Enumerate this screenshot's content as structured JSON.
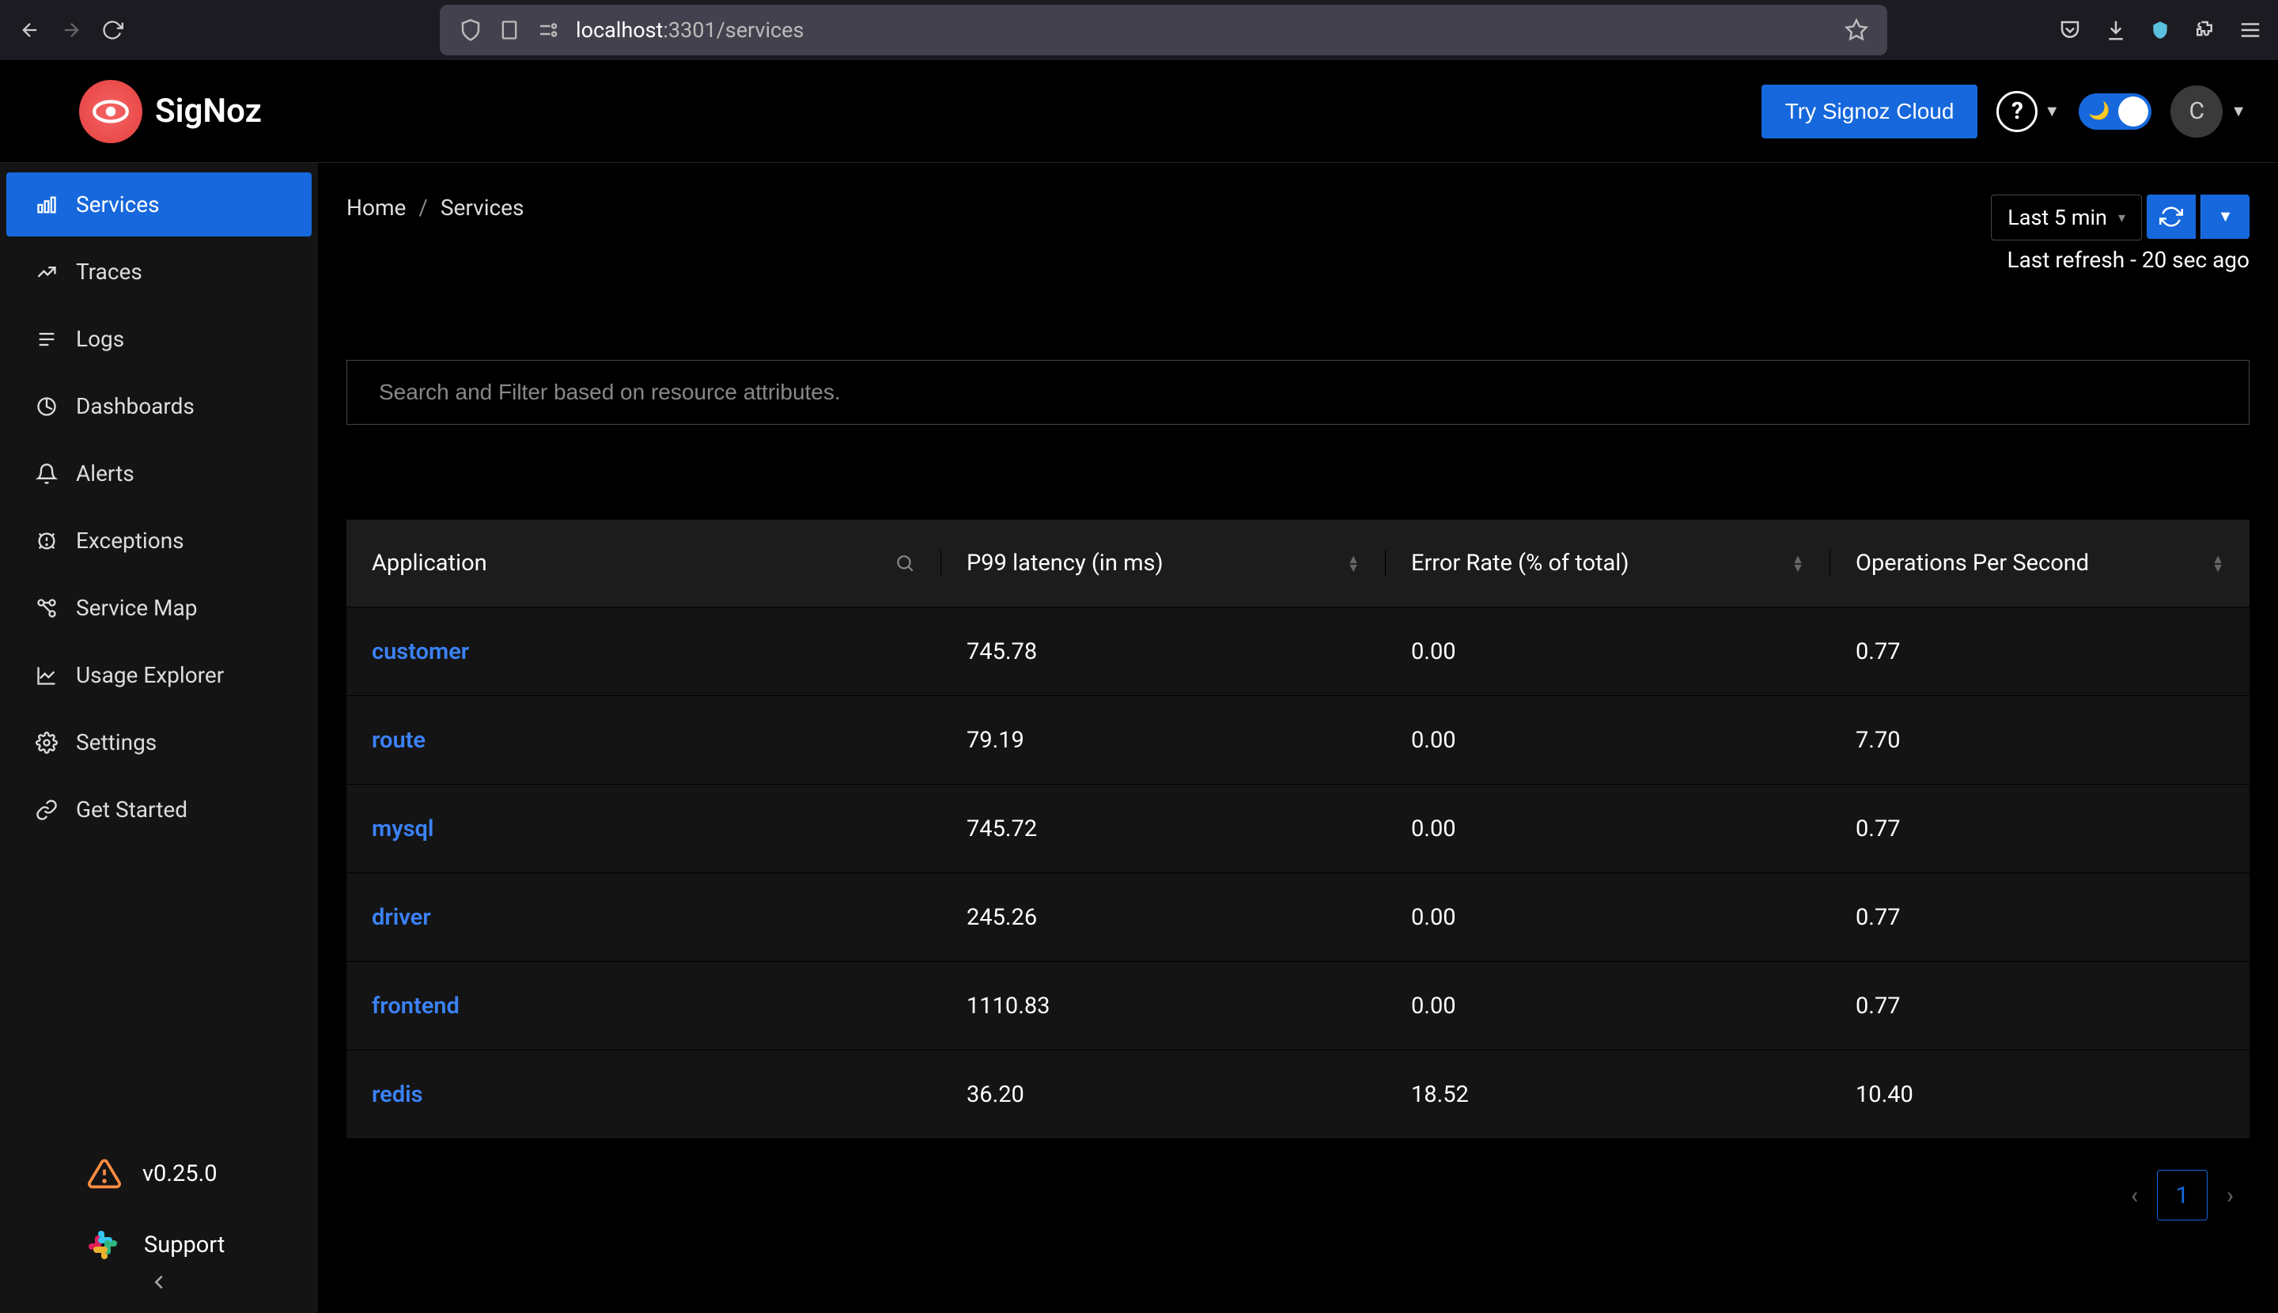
{
  "browser": {
    "url_prefix": "localhost",
    "url_suffix": ":3301/services"
  },
  "app_name": "SigNoz",
  "header": {
    "try_cloud": "Try Signoz Cloud",
    "user_initial": "C"
  },
  "sidebar": {
    "items": [
      {
        "id": "services",
        "label": "Services",
        "active": true
      },
      {
        "id": "traces",
        "label": "Traces",
        "active": false
      },
      {
        "id": "logs",
        "label": "Logs",
        "active": false
      },
      {
        "id": "dashboards",
        "label": "Dashboards",
        "active": false
      },
      {
        "id": "alerts",
        "label": "Alerts",
        "active": false
      },
      {
        "id": "exceptions",
        "label": "Exceptions",
        "active": false
      },
      {
        "id": "service-map",
        "label": "Service Map",
        "active": false
      },
      {
        "id": "usage-explorer",
        "label": "Usage Explorer",
        "active": false
      },
      {
        "id": "settings",
        "label": "Settings",
        "active": false
      },
      {
        "id": "get-started",
        "label": "Get Started",
        "active": false
      }
    ],
    "version": "v0.25.0",
    "support": "Support"
  },
  "breadcrumb": {
    "home": "Home",
    "current": "Services"
  },
  "time_controls": {
    "range_label": "Last 5 min",
    "last_refresh": "Last refresh - 20 sec ago"
  },
  "search": {
    "placeholder": "Search and Filter based on resource attributes."
  },
  "table": {
    "columns": {
      "application": "Application",
      "p99": "P99 latency (in ms)",
      "error_rate": "Error Rate (% of total)",
      "ops": "Operations Per Second"
    },
    "rows": [
      {
        "app": "customer",
        "p99": "745.78",
        "err": "0.00",
        "ops": "0.77"
      },
      {
        "app": "route",
        "p99": "79.19",
        "err": "0.00",
        "ops": "7.70"
      },
      {
        "app": "mysql",
        "p99": "745.72",
        "err": "0.00",
        "ops": "0.77"
      },
      {
        "app": "driver",
        "p99": "245.26",
        "err": "0.00",
        "ops": "0.77"
      },
      {
        "app": "frontend",
        "p99": "1110.83",
        "err": "0.00",
        "ops": "0.77"
      },
      {
        "app": "redis",
        "p99": "36.20",
        "err": "18.52",
        "ops": "10.40"
      }
    ]
  },
  "pagination": {
    "current": "1"
  }
}
